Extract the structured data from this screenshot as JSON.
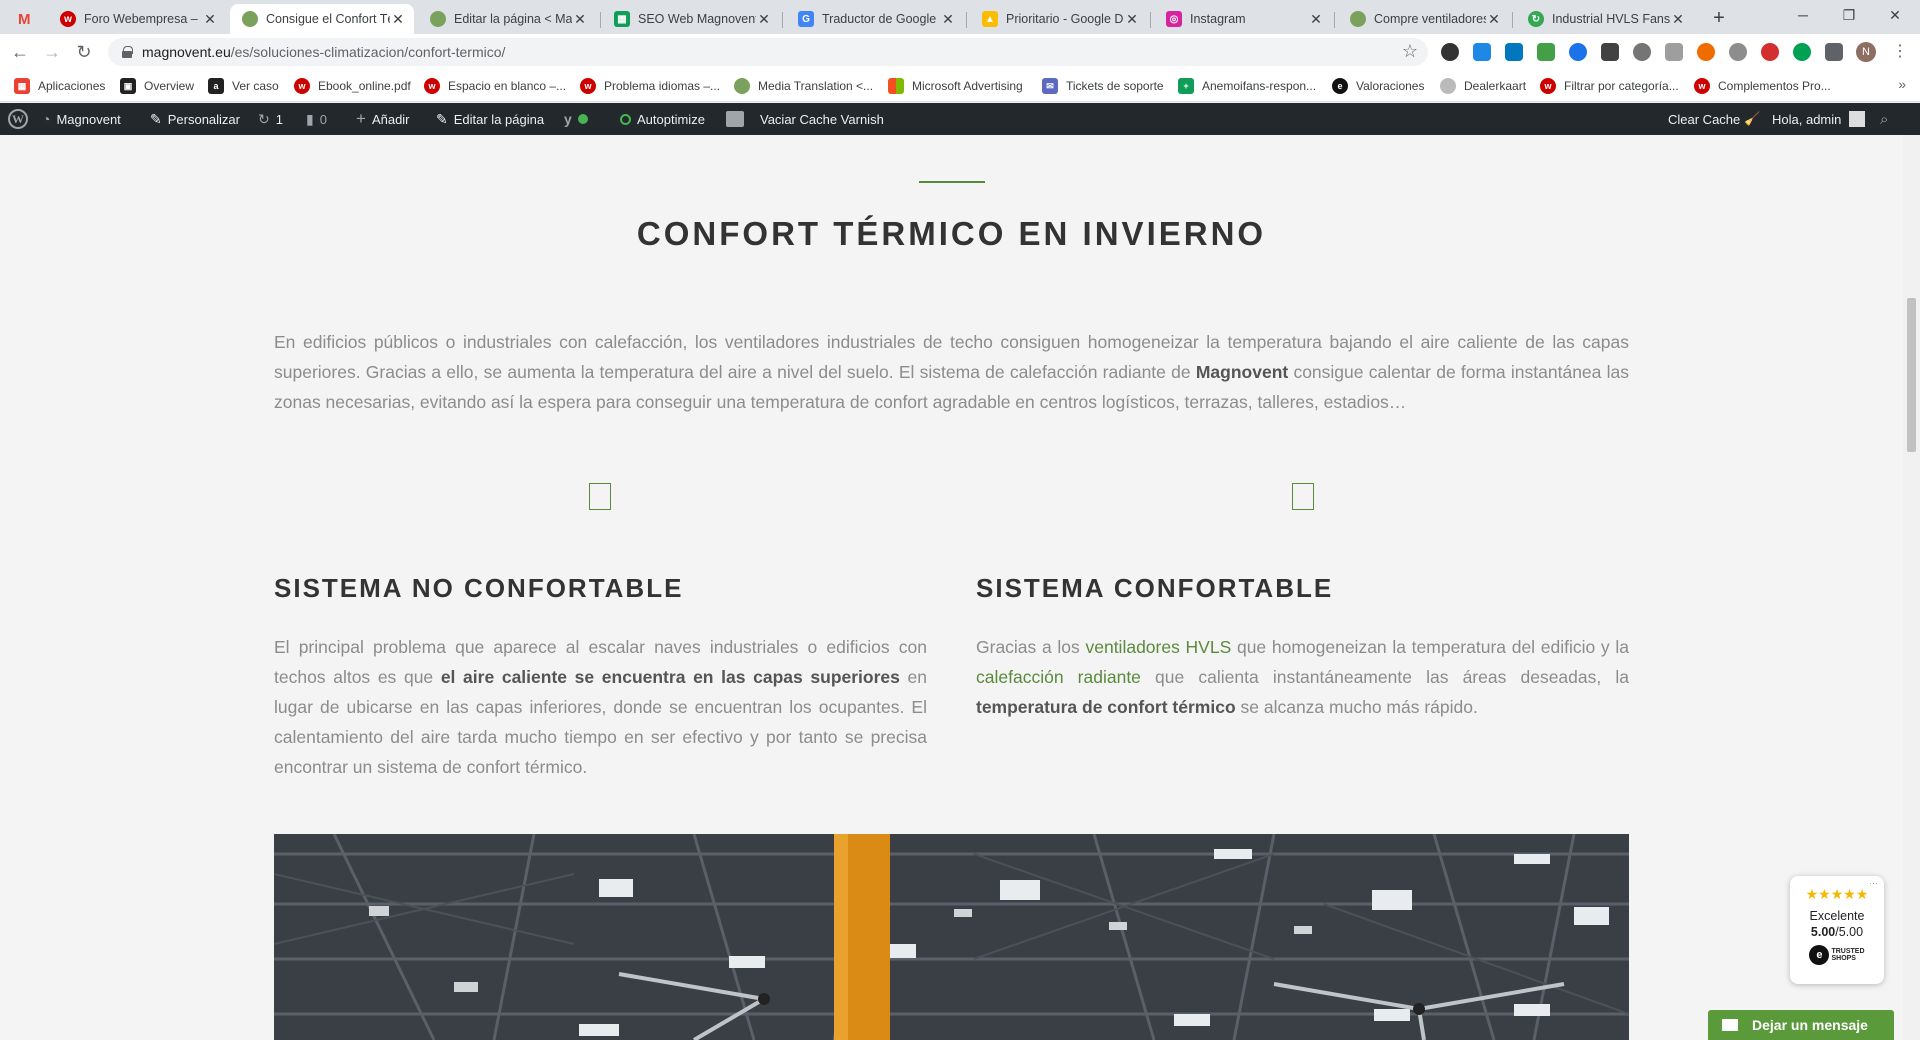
{
  "browser": {
    "tabs": [
      {
        "title": "Foro Webempresa – Fo",
        "favicon": "webempresa-icon",
        "color": "#cc0000"
      },
      {
        "title": "Consigue el Confort Té",
        "favicon": "magnovent-icon",
        "color": "#7aa25c"
      },
      {
        "title": "Editar la página < Mag",
        "favicon": "magnovent-icon",
        "color": "#7aa25c"
      },
      {
        "title": "SEO Web Magnovent",
        "favicon": "sheets-icon",
        "color": "#0f9d58"
      },
      {
        "title": "Traductor de Google",
        "favicon": "translate-icon",
        "color": "#4285f4"
      },
      {
        "title": "Prioritario - Google Dr",
        "favicon": "drive-icon",
        "color": "#fbbc04"
      },
      {
        "title": "Instagram",
        "favicon": "instagram-icon",
        "color": "#d6249f"
      },
      {
        "title": "Compre ventiladores y",
        "favicon": "magnovent-icon",
        "color": "#7aa25c"
      },
      {
        "title": "Industrial HVLS Fans -",
        "favicon": "refresh-icon",
        "color": "#34a853"
      }
    ],
    "url_host": "magnovent.eu",
    "url_path": "/es/soluciones-climatizacion/confort-termico/",
    "profile_initial": "N",
    "bookmarks": [
      {
        "label": "Aplicaciones",
        "icon": "apps-grid-icon",
        "color": "#e94235"
      },
      {
        "label": "Overview",
        "icon": "overview-icon",
        "color": "#222222"
      },
      {
        "label": "Ver caso",
        "icon": "amazon-icon",
        "color": "#222222"
      },
      {
        "label": "Ebook_online.pdf",
        "icon": "webempresa-icon",
        "color": "#cc0000"
      },
      {
        "label": "Espacio en blanco –...",
        "icon": "webempresa-icon",
        "color": "#cc0000"
      },
      {
        "label": "Problema idiomas –...",
        "icon": "webempresa-icon",
        "color": "#cc0000"
      },
      {
        "label": "Media Translation <...",
        "icon": "magnovent-icon",
        "color": "#7aa25c"
      },
      {
        "label": "Microsoft Advertising",
        "icon": "microsoft-icon",
        "color": "#f25022"
      },
      {
        "label": "Tickets de soporte",
        "icon": "ticket-icon",
        "color": "#5c6bc0"
      },
      {
        "label": "Anemoifans-respon...",
        "icon": "sheets-icon",
        "color": "#0f9d58"
      },
      {
        "label": "Valoraciones",
        "icon": "trustedshops-icon",
        "color": "#111111"
      },
      {
        "label": "Dealerkaart",
        "icon": "dealer-icon",
        "color": "#bbbbbb"
      },
      {
        "label": "Filtrar por categoría...",
        "icon": "webempresa-icon",
        "color": "#cc0000"
      },
      {
        "label": "Complementos Pro...",
        "icon": "webempresa-icon",
        "color": "#cc0000"
      }
    ]
  },
  "wpbar": {
    "site": "Magnovent",
    "customize": "Personalizar",
    "updates": "1",
    "comments": "0",
    "add_new": "Añadir",
    "edit_page": "Editar la página",
    "autoptimize": "Autoptimize",
    "varnish": "Vaciar Cache Varnish",
    "clear_cache": "Clear Cache",
    "greeting": "Hola, admin"
  },
  "content": {
    "title": "CONFORT TÉRMICO EN INVIERNO",
    "intro_1": "En edificios públicos o industriales con calefacción, los ventiladores industriales de techo consiguen homogeneizar la temperatura bajando el aire caliente de las capas superiores. Gracias a ello, se aumenta la temperatura del aire a nivel del suelo. El sistema de calefacción radiante de ",
    "intro_brand": "Magnovent",
    "intro_2": " consigue calentar de forma instantánea las zonas necesarias, evitando así la espera para conseguir una temperatura de confort agradable en centros logísticos, terrazas, talleres, estadios…",
    "left": {
      "title": "SISTEMA NO CONFORTABLE",
      "text_1": "El principal problema que aparece al escalar naves industriales o edificios con techos altos es que ",
      "bold_1": "el aire caliente se encuentra en las capas superiores",
      "text_2": " en lugar de ubicarse en las capas inferiores, donde se encuentran los ocupantes. El calentamiento del aire tarda mucho tiempo en ser efectivo y por tanto se precisa encontrar un sistema de confort térmico."
    },
    "right": {
      "title": "SISTEMA CONFORTABLE",
      "text_1": "Gracias a los ",
      "link_1": "ventiladores HVLS",
      "text_2": " que homogeneizan la temperatura del edificio y la ",
      "link_2": "calefacción radiante",
      "text_3": " que calienta instantáneamente las áreas deseadas, la ",
      "bold_1": "temperatura de confort térmico",
      "text_4": " se alcanza mucho más rápido."
    }
  },
  "trusted_shops": {
    "stars": "★★★★★",
    "rating_label": "Excelente",
    "score": "5.00",
    "score_max": "/5.00",
    "logo_text_1": "TRUSTED",
    "logo_text_2": "SHOPS"
  },
  "chat": {
    "label": "Dejar un mensaje"
  },
  "colors": {
    "accent": "#5a8a3c",
    "wpbar": "#23282d",
    "chat": "#5a9a3a"
  }
}
